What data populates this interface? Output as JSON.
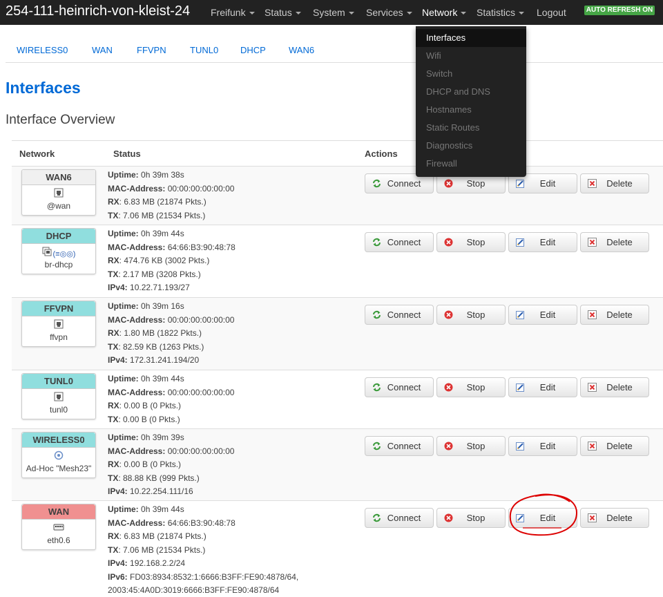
{
  "header": {
    "hostname": "254-111-heinrich-von-kleist-24",
    "menu": [
      "Freifunk",
      "Status",
      "System",
      "Services",
      "Network",
      "Statistics",
      "Logout"
    ],
    "auto_refresh": "AUTO REFRESH ON"
  },
  "network_menu": [
    "Interfaces",
    "Wifi",
    "Switch",
    "DHCP and DNS",
    "Hostnames",
    "Static Routes",
    "Diagnostics",
    "Firewall"
  ],
  "tabs": [
    "WIRELESS0",
    "WAN",
    "FFVPN",
    "TUNL0",
    "DHCP",
    "WAN6"
  ],
  "page": {
    "title": "Interfaces",
    "section": "Interface Overview"
  },
  "table": {
    "headers": {
      "network": "Network",
      "status": "Status",
      "actions": "Actions"
    },
    "labels": {
      "uptime": "Uptime:",
      "mac": "MAC-Address:",
      "rx": "RX",
      "tx": "TX",
      "ipv4": "IPv4:",
      "ipv6": "IPv6:"
    },
    "buttons": {
      "connect": "Connect",
      "stop": "Stop",
      "edit": "Edit",
      "delete": "Delete"
    },
    "rows": [
      {
        "name": "WAN6",
        "color": "#f0f0f0",
        "device": "@wan",
        "icon": "ethernet-port-icon",
        "uptime": "0h 39m 38s",
        "mac": "00:00:00:00:00:00",
        "rx": ": 6.83 MB (21874 Pkts.)",
        "tx": ": 7.06 MB (21534 Pkts.)"
      },
      {
        "name": "DHCP",
        "color": "#90dede",
        "device": "br-dhcp",
        "icon": "bridge-icon",
        "icon_text": "(≡◎◎)",
        "uptime": "0h 39m 44s",
        "mac": "64:66:B3:90:48:78",
        "rx": ": 474.76 KB (3002 Pkts.)",
        "tx": ": 2.17 MB (3208 Pkts.)",
        "ipv4": "10.22.71.193/27"
      },
      {
        "name": "FFVPN",
        "color": "#90dede",
        "device": "ffvpn",
        "icon": "ethernet-port-icon",
        "uptime": "0h 39m 16s",
        "mac": "00:00:00:00:00:00",
        "rx": ": 1.80 MB (1822 Pkts.)",
        "tx": ": 82.59 KB (1263 Pkts.)",
        "ipv4": "172.31.241.194/20"
      },
      {
        "name": "TUNL0",
        "color": "#90dede",
        "device": "tunl0",
        "icon": "ethernet-port-icon",
        "uptime": "0h 39m 44s",
        "mac": "00:00:00:00:00:00",
        "rx": ": 0.00 B (0 Pkts.)",
        "tx": ": 0.00 B (0 Pkts.)"
      },
      {
        "name": "WIRELESS0",
        "color": "#90dede",
        "device": "Ad-Hoc \"Mesh23\"",
        "icon": "wireless-icon",
        "uptime": "0h 39m 39s",
        "mac": "00:00:00:00:00:00",
        "rx": ": 0.00 B (0 Pkts.)",
        "tx": ": 88.88 KB (999 Pkts.)",
        "ipv4": "10.22.254.111/16"
      },
      {
        "name": "WAN",
        "color": "#f09090",
        "device": "eth0.6",
        "icon": "switch-icon",
        "uptime": "0h 39m 44s",
        "mac": "64:66:B3:90:48:78",
        "rx": ": 6.83 MB (21874 Pkts.)",
        "tx": ": 7.06 MB (21534 Pkts.)",
        "ipv4": "192.168.2.2/24",
        "ipv6": "FD03:8934:8532:1:6666:B3FF:FE90:4878/64,",
        "ipv6_2": "2003:45:4A0D:3019:6666:B3FF:FE90:4878/64"
      }
    ]
  },
  "colors": {
    "navbar": "#222222",
    "link": "#0069d6",
    "annotation": "#dd0000",
    "auto_refresh": "#46a546"
  }
}
